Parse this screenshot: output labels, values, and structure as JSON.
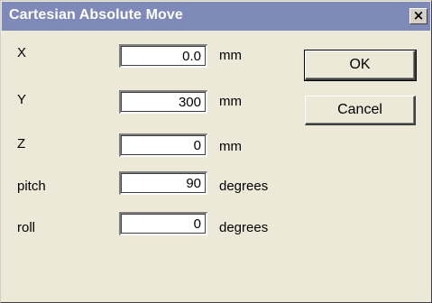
{
  "window": {
    "title": "Cartesian Absolute Move",
    "close_symbol": "×"
  },
  "fields": [
    {
      "label": "X",
      "value": "0.0",
      "unit": "mm"
    },
    {
      "label": "Y",
      "value": "300",
      "unit": "mm"
    },
    {
      "label": "Z",
      "value": "0",
      "unit": "mm"
    },
    {
      "label": "pitch",
      "value": "90",
      "unit": "degrees"
    },
    {
      "label": "roll",
      "value": "0",
      "unit": "degrees"
    }
  ],
  "buttons": {
    "ok_label": "OK",
    "cancel_label": "Cancel"
  },
  "colors": {
    "titlebar": "#7f8ab8",
    "dialog_bg": "#ece9d8",
    "field_bg": "#ffffff"
  }
}
